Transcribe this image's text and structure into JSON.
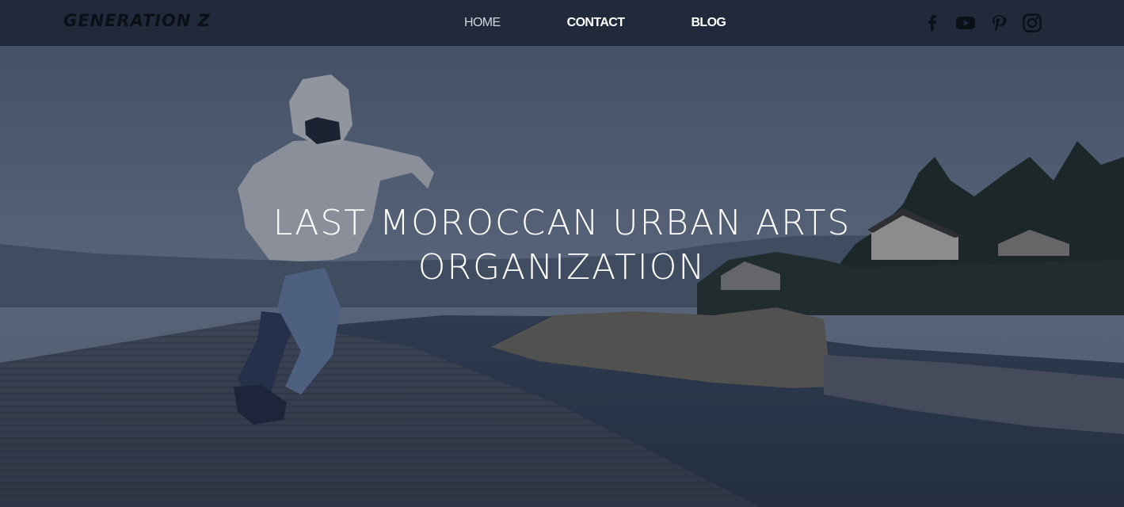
{
  "header": {
    "logo_text": "GENERATION Z",
    "nav": [
      {
        "label": "HOME",
        "active": true
      },
      {
        "label": "CONTACT",
        "active": false
      },
      {
        "label": "BLOG",
        "active": false
      }
    ],
    "social_icons": [
      "facebook-icon",
      "youtube-icon",
      "pinterest-icon",
      "instagram-icon"
    ]
  },
  "hero": {
    "title_line1": "LAST MOROCCAN URBAN ARTS",
    "title_line2": "ORGANIZATION"
  },
  "colors": {
    "header_bg": "#202a3b",
    "overlay": "#1b2333",
    "text": "#ffffff"
  }
}
